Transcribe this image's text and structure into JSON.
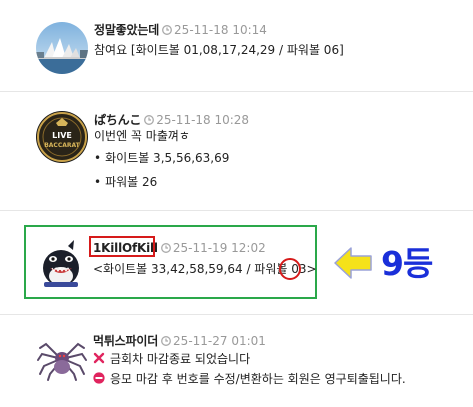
{
  "comments": [
    {
      "author": "정말좋았는데",
      "date": "25-11-18 10:14",
      "lines": [
        "참여요 [화이트볼 01,08,17,24,29 / 파워볼 06]"
      ]
    },
    {
      "author": "ぱちんこ",
      "date": "25-11-18 10:28",
      "avatar_text": [
        "LIVE",
        "BACCARAT"
      ],
      "lines": [
        "이번엔 꼭 마출껴ㅎ",
        "화이트볼 3,5,56,63,69",
        "파워볼 26"
      ],
      "bullet": "•"
    },
    {
      "author": "1KillOfKill",
      "date": "25-11-19 12:02",
      "lines": [
        "<화이트볼 33,42,58,59,64 / 파워볼 03>"
      ]
    },
    {
      "author": "먹튀스파이더",
      "date": "25-11-27 01:01",
      "lines": [
        "금회차 마감종료 되었습니다",
        "응모 마감 후 번호를 수정/변환하는 회원은 영구퇴출됩니다."
      ]
    }
  ],
  "annotation": {
    "rank_label": "9등",
    "arrow_color": "#f5e21a",
    "box_color": "#2aa84a",
    "highlight_color": "#d61a1a",
    "rank_color": "#1a2fd9"
  }
}
